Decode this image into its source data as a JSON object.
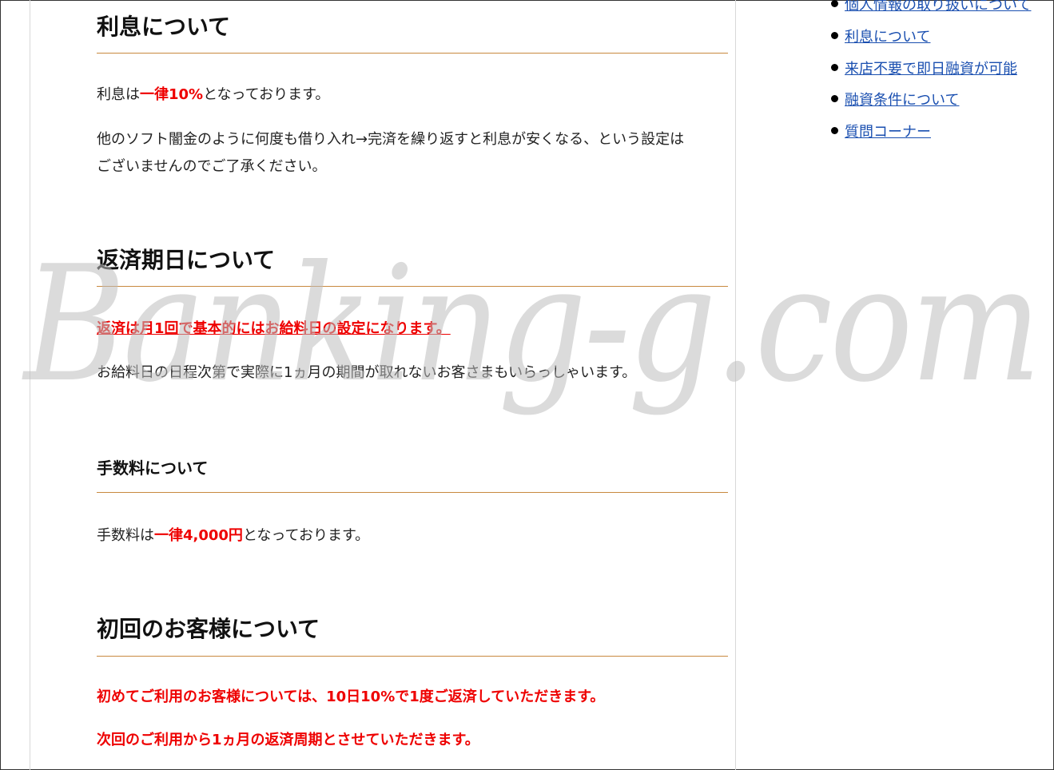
{
  "main": {
    "interest": {
      "heading": "利息について",
      "line1_pre": "利息は",
      "line1_red": "一律10%",
      "line1_post": "となっております。",
      "line2": "他のソフト闇金のように何度も借り入れ→完済を繰り返すと利息が安くなる、という設定は",
      "line3": "ございませんのでご了承ください。"
    },
    "repayment": {
      "heading": "返済期日について",
      "link_text": "返済は月1回で基本的にはお給料日の設定になります。",
      "note": "お給料日の日程次第で実際に1ヵ月の期間が取れないお客さまもいらっしゃいます。"
    },
    "fee": {
      "heading": "手数料について",
      "line_pre": "手数料は",
      "line_red": "一律4,000円",
      "line_post": "となっております。"
    },
    "first_time": {
      "heading": "初回のお客様について",
      "line1": "初めてご利用のお客様については、10日10%で1度ご返済していただきます。",
      "line2": "次回のご利用から1ヵ月の返済周期とさせていただきます。"
    }
  },
  "sidebar": {
    "items": [
      {
        "label": "個人情報の取り扱いについて"
      },
      {
        "label": "利息について"
      },
      {
        "label": "来店不要で即日融資が可能"
      },
      {
        "label": "融資条件について"
      },
      {
        "label": "質問コーナー"
      }
    ]
  },
  "watermark": {
    "text": "Banking-g.com"
  },
  "colors": {
    "accent_red": "#ee0000",
    "rule": "#c8893f",
    "link": "#1a4fb0"
  }
}
